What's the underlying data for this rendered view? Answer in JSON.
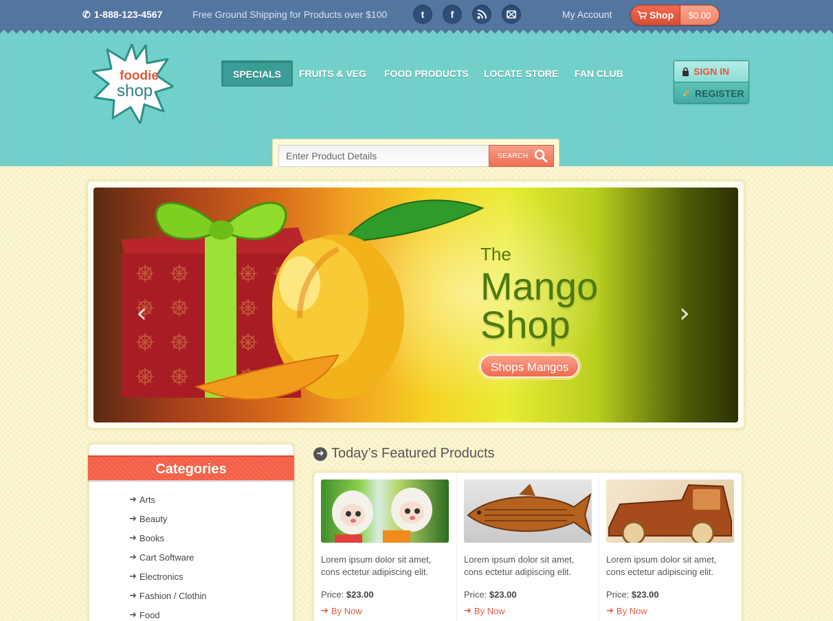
{
  "topbar": {
    "phone": "1-888-123-4567",
    "shipping_note": "Free Ground Shipping for Products over $100",
    "social": [
      "t",
      "f",
      "rss",
      "mail"
    ],
    "my_account": "My Account",
    "cart_label": "Shop",
    "cart_total": "$0.00"
  },
  "logo": {
    "line1": "foodie",
    "line2": "shop"
  },
  "nav": {
    "items": [
      {
        "label": "SPECIALS"
      },
      {
        "label": "FRUITS & VEG"
      },
      {
        "label": "FOOD PRODUCTS"
      },
      {
        "label": "LOCATE STORE"
      },
      {
        "label": "FAN CLUB"
      }
    ],
    "active_index": 0
  },
  "auth": {
    "sign_in": "SIGN IN",
    "register": "REGISTER"
  },
  "search": {
    "placeholder": "Enter Product Details",
    "button": "SEARCH"
  },
  "banner": {
    "line1": "The",
    "line2": "Mango",
    "line3": "Shop",
    "button": "Shops Mangos"
  },
  "sidebar": {
    "title": "Categories",
    "items": [
      "Arts",
      "Beauty",
      "Books",
      "Cart Software",
      "Electronics",
      "Fashion / Clothin",
      "Food"
    ]
  },
  "featured": {
    "title": "Today’s Featured Products",
    "products": [
      {
        "desc": "Lorem ipsum dolor sit amet, cons ectetur adipiscing elit.",
        "price_label": "Price:",
        "price": "$23.00",
        "buy": "By Now"
      },
      {
        "desc": "Lorem ipsum dolor sit amet, cons ectetur adipiscing elit.",
        "price_label": "Price:",
        "price": "$23.00",
        "buy": "By Now"
      },
      {
        "desc": "Lorem ipsum dolor sit amet, cons ectetur adipiscing elit.",
        "price_label": "Price:",
        "price": "$23.00",
        "buy": "By Now"
      }
    ]
  },
  "colors": {
    "topbar": "#50749e",
    "header": "#6acdc7",
    "accent": "#f45f45",
    "background": "#fbf6d4"
  }
}
